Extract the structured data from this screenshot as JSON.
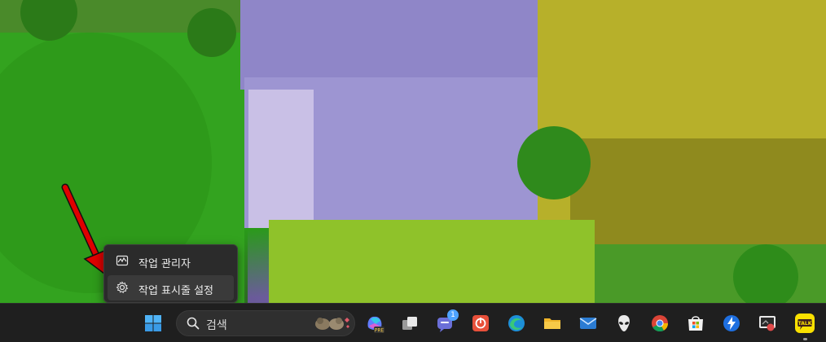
{
  "context_menu": {
    "items": [
      {
        "label": "작업 관리자",
        "icon": "task-manager-icon"
      },
      {
        "label": "작업 표시줄 설정",
        "icon": "gear-icon"
      }
    ]
  },
  "taskbar": {
    "search_label": "검색",
    "apps": [
      {
        "name": "start-button",
        "icon": "windows-logo-icon"
      },
      {
        "name": "copilot-button",
        "icon": "copilot-icon",
        "badge": "PRE"
      },
      {
        "name": "task-view-button",
        "icon": "task-view-icon"
      },
      {
        "name": "teams-button",
        "icon": "chat-icon",
        "badge": "1"
      },
      {
        "name": "app-red-button",
        "icon": "power-icon"
      },
      {
        "name": "edge-button",
        "icon": "edge-icon"
      },
      {
        "name": "file-explorer-button",
        "icon": "folder-icon"
      },
      {
        "name": "mail-button",
        "icon": "mail-icon"
      },
      {
        "name": "alienware-button",
        "icon": "alien-icon"
      },
      {
        "name": "chrome-button",
        "icon": "chrome-icon"
      },
      {
        "name": "store-button",
        "icon": "store-icon"
      },
      {
        "name": "app-blue-button",
        "icon": "bolt-icon"
      },
      {
        "name": "snipping-button",
        "icon": "screen-capture-icon"
      },
      {
        "name": "kakaotalk-button",
        "icon": "kakaotalk-icon",
        "badge": "TALK"
      }
    ]
  },
  "colors": {
    "taskbar": "#1f1f1f",
    "menu": "#2b2b2b",
    "arrow": "#e00000"
  }
}
